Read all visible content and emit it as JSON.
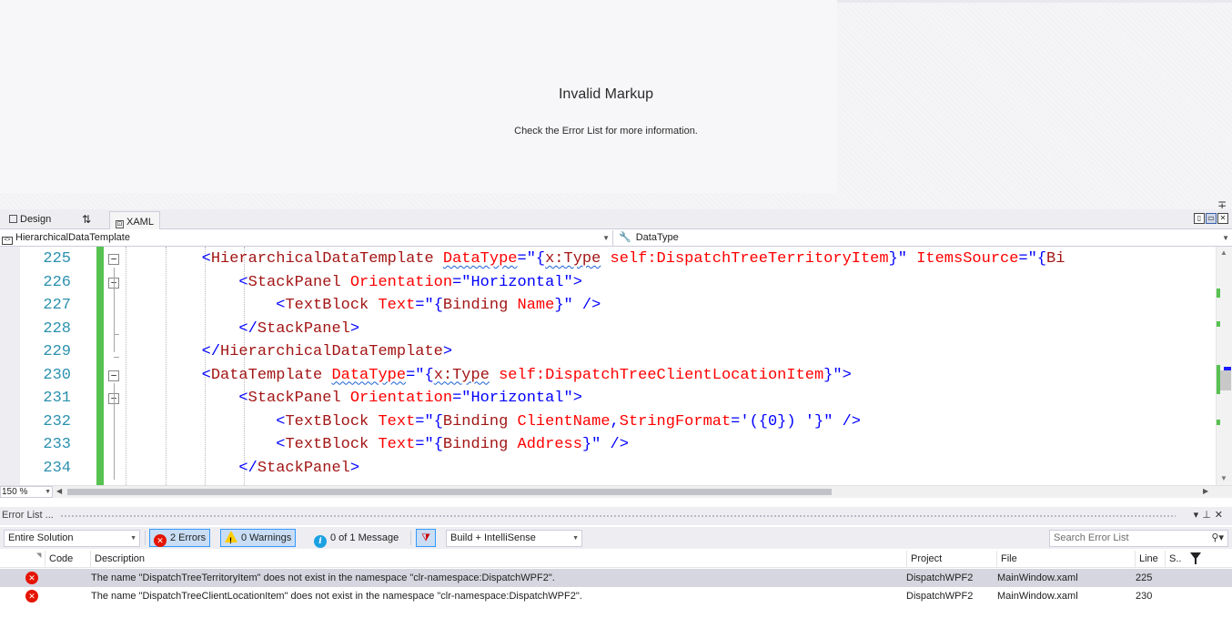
{
  "designer": {
    "title": "Invalid Markup",
    "subtitle": "Check the Error List for more information."
  },
  "tabs": {
    "design": "Design",
    "swap": "⇅",
    "xaml": "XAML"
  },
  "navbar": {
    "left": "HierarchicalDataTemplate",
    "right": "DataType"
  },
  "editor": {
    "line_numbers": [
      "225",
      "226",
      "227",
      "228",
      "229",
      "230",
      "231",
      "232",
      "233",
      "234"
    ],
    "zoom": "150 %"
  },
  "error_list": {
    "title": "Error List ...",
    "scope": "Entire Solution",
    "errors_label": "2 Errors",
    "warnings_label": "0 Warnings",
    "messages_label": "0 of 1 Message",
    "build_filter": "Build + IntelliSense",
    "search_placeholder": "Search Error List",
    "columns": {
      "code": "Code",
      "description": "Description",
      "project": "Project",
      "file": "File",
      "line": "Line",
      "suppression": "S.."
    },
    "rows": [
      {
        "description": "The name \"DispatchTreeTerritoryItem\" does not exist in the namespace \"clr-namespace:DispatchWPF2\".",
        "project": "DispatchWPF2",
        "file": "MainWindow.xaml",
        "line": "225"
      },
      {
        "description": "The name \"DispatchTreeClientLocationItem\" does not exist in the namespace \"clr-namespace:DispatchWPF2\".",
        "project": "DispatchWPF2",
        "file": "MainWindow.xaml",
        "line": "230"
      }
    ]
  },
  "colors": {
    "tag": "#a31515",
    "attribute": "#ff0000",
    "value": "#0000ff",
    "line_number": "#2b91af",
    "change_bar": "#57c251",
    "error": "#e51400"
  },
  "code_lines": [
    [
      [
        "ind",
        "        "
      ],
      [
        "punc",
        "<"
      ],
      [
        "tag",
        "HierarchicalDataTemplate"
      ],
      [
        "txt",
        " "
      ],
      [
        "attr",
        "DataType",
        "squig"
      ],
      [
        "punc",
        "=\""
      ],
      [
        "val",
        "{"
      ],
      [
        "tag",
        "x:Type",
        "squig"
      ],
      [
        "val",
        " "
      ],
      [
        "attr",
        "self:DispatchTreeTerritoryItem"
      ],
      [
        "val",
        "}"
      ],
      [
        "punc",
        "\""
      ],
      [
        "txt",
        " "
      ],
      [
        "attr",
        "ItemsSource"
      ],
      [
        "punc",
        "=\""
      ],
      [
        "val",
        "{"
      ],
      [
        "tag",
        "Bi"
      ]
    ],
    [
      [
        "ind",
        "            "
      ],
      [
        "punc",
        "<"
      ],
      [
        "tag",
        "StackPanel"
      ],
      [
        "txt",
        " "
      ],
      [
        "attr",
        "Orientation"
      ],
      [
        "punc",
        "=\""
      ],
      [
        "val",
        "Horizontal"
      ],
      [
        "punc",
        "\">"
      ]
    ],
    [
      [
        "ind",
        "                "
      ],
      [
        "punc",
        "<"
      ],
      [
        "tag",
        "TextBlock"
      ],
      [
        "txt",
        " "
      ],
      [
        "attr",
        "Text"
      ],
      [
        "punc",
        "=\""
      ],
      [
        "val",
        "{"
      ],
      [
        "tag",
        "Binding"
      ],
      [
        "val",
        " "
      ],
      [
        "attr",
        "Name"
      ],
      [
        "val",
        "}"
      ],
      [
        "punc",
        "\" />"
      ]
    ],
    [
      [
        "ind",
        "            "
      ],
      [
        "punc",
        "</"
      ],
      [
        "tag",
        "StackPanel"
      ],
      [
        "punc",
        ">"
      ]
    ],
    [
      [
        "ind",
        "        "
      ],
      [
        "punc",
        "</"
      ],
      [
        "tag",
        "HierarchicalDataTemplate"
      ],
      [
        "punc",
        ">"
      ]
    ],
    [
      [
        "ind",
        "        "
      ],
      [
        "punc",
        "<"
      ],
      [
        "tag",
        "DataTemplate"
      ],
      [
        "txt",
        " "
      ],
      [
        "attr",
        "DataType",
        "squig"
      ],
      [
        "punc",
        "=\""
      ],
      [
        "val",
        "{"
      ],
      [
        "tag",
        "x:Type",
        "squig"
      ],
      [
        "val",
        " "
      ],
      [
        "attr",
        "self:DispatchTreeClientLocationItem"
      ],
      [
        "val",
        "}"
      ],
      [
        "punc",
        "\">"
      ]
    ],
    [
      [
        "ind",
        "            "
      ],
      [
        "punc",
        "<"
      ],
      [
        "tag",
        "StackPanel"
      ],
      [
        "txt",
        " "
      ],
      [
        "attr",
        "Orientation"
      ],
      [
        "punc",
        "=\""
      ],
      [
        "val",
        "Horizontal"
      ],
      [
        "punc",
        "\">"
      ]
    ],
    [
      [
        "ind",
        "                "
      ],
      [
        "punc",
        "<"
      ],
      [
        "tag",
        "TextBlock"
      ],
      [
        "txt",
        " "
      ],
      [
        "attr",
        "Text"
      ],
      [
        "punc",
        "=\""
      ],
      [
        "val",
        "{"
      ],
      [
        "tag",
        "Binding"
      ],
      [
        "val",
        " "
      ],
      [
        "attr",
        "ClientName"
      ],
      [
        "val",
        ","
      ],
      [
        "attr",
        "StringFormat"
      ],
      [
        "val",
        "='({0}) '}"
      ],
      [
        "punc",
        "\" />"
      ]
    ],
    [
      [
        "ind",
        "                "
      ],
      [
        "punc",
        "<"
      ],
      [
        "tag",
        "TextBlock"
      ],
      [
        "txt",
        " "
      ],
      [
        "attr",
        "Text"
      ],
      [
        "punc",
        "=\""
      ],
      [
        "val",
        "{"
      ],
      [
        "tag",
        "Binding"
      ],
      [
        "val",
        " "
      ],
      [
        "attr",
        "Address"
      ],
      [
        "val",
        "}"
      ],
      [
        "punc",
        "\" />"
      ]
    ],
    [
      [
        "ind",
        "            "
      ],
      [
        "punc",
        "</"
      ],
      [
        "tag",
        "StackPanel"
      ],
      [
        "punc",
        ">"
      ]
    ]
  ]
}
